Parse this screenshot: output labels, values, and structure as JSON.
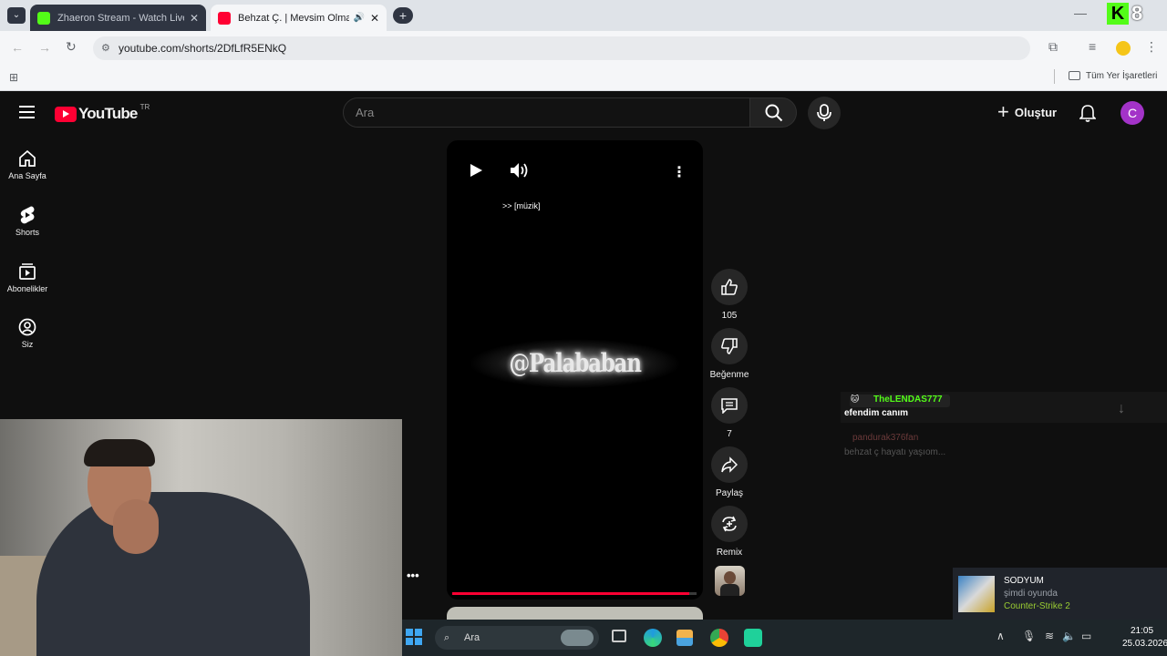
{
  "browser": {
    "tabs": [
      {
        "title": "Zhaeron Stream - Watch Live on Kick",
        "favicon_color": "#53fc18"
      },
      {
        "title": "Behzat Ç. | Mevsim Olmayan Ülke",
        "favicon_color": "#ff0033"
      }
    ],
    "url": "youtube.com/shorts/2DfLfR5ENkQ",
    "bookmarks_label": "Tüm Yer İşaretleri"
  },
  "overlay_kick": {
    "logo": "K",
    "count": "8"
  },
  "youtube": {
    "logo_text": "YouTube",
    "region": "TR",
    "search_placeholder": "Ara",
    "create_label": "Oluştur",
    "avatar_letter": "C",
    "nav": [
      {
        "label": "Ana Sayfa",
        "icon": "home-icon"
      },
      {
        "label": "Shorts",
        "icon": "shorts-icon"
      },
      {
        "label": "Abonelikler",
        "icon": "subscriptions-icon"
      },
      {
        "label": "Siz",
        "icon": "account-icon"
      }
    ],
    "video": {
      "caption": ">> [müzik]",
      "watermark": "@Palababan",
      "progress": 0.97
    },
    "actions": {
      "likes": "105",
      "dislike_label": "Beğenme",
      "comments": "7",
      "share_label": "Paylaş",
      "remix_label": "Remix"
    }
  },
  "chat": {
    "messages": [
      {
        "user": "TheLENDAS777",
        "text": "efendim canım"
      },
      {
        "user": "pandurak376fan",
        "text": "behzat ç hayatı yaşıom..."
      }
    ]
  },
  "steam": {
    "name": "SODYUM",
    "status": "şimdi oyunda",
    "game": "Counter-Strike 2"
  },
  "taskbar": {
    "search_label": "Ara",
    "time": "21:05",
    "date": "25.03.2026"
  },
  "colors": {
    "yt_red": "#ff0033",
    "avatar": "#a333c8",
    "kick_green": "#53fc18"
  }
}
